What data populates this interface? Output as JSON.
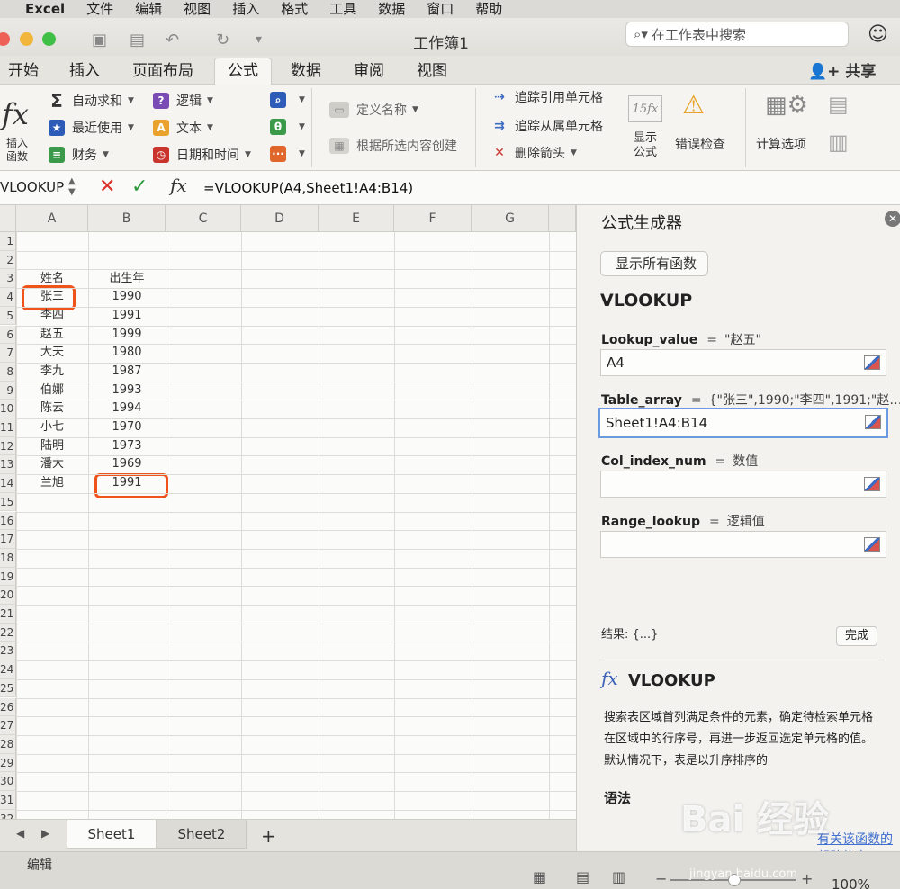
{
  "menubar": {
    "items": [
      "Excel",
      "文件",
      "编辑",
      "视图",
      "插入",
      "格式",
      "工具",
      "数据",
      "窗口",
      "帮助"
    ]
  },
  "window": {
    "title": "工作簿1"
  },
  "search": {
    "placeholder": "在工作表中搜索"
  },
  "tabs": [
    "开始",
    "插入",
    "页面布局",
    "公式",
    "数据",
    "审阅",
    "视图"
  ],
  "active_tab": "公式",
  "share_label": "共享",
  "ribbon": {
    "insert_function": "插入\n函数",
    "autosum": "自动求和",
    "recently_used": "最近使用",
    "financial": "财务",
    "logical": "逻辑",
    "text": "文本",
    "date_time": "日期和时间",
    "define_name": "定义名称",
    "create_from_selection": "根据所选内容创建",
    "trace_precedents": "追踪引用单元格",
    "trace_dependents": "追踪从属单元格",
    "remove_arrows": "删除箭头",
    "show_formulas": "显示\n公式",
    "error_checking": "错误检查",
    "calc_options": "计算选项"
  },
  "formula_bar": {
    "name_box": "VLOOKUP",
    "formula": "=VLOOKUP(A4,Sheet1!A4:B14)"
  },
  "grid": {
    "columns": [
      "A",
      "B",
      "C",
      "D",
      "E",
      "F",
      "G"
    ],
    "header_row": {
      "a": "姓名",
      "b": "出生年"
    },
    "rows": [
      {
        "a": "张三",
        "b": "1990"
      },
      {
        "a": "李四",
        "b": "1991"
      },
      {
        "a": "赵五",
        "b": "1999"
      },
      {
        "a": "大天",
        "b": "1980"
      },
      {
        "a": "李九",
        "b": "1987"
      },
      {
        "a": "伯娜",
        "b": "1993"
      },
      {
        "a": "陈云",
        "b": "1994"
      },
      {
        "a": "小七",
        "b": "1970"
      },
      {
        "a": "陆明",
        "b": "1973"
      },
      {
        "a": "潘大",
        "b": "1969"
      },
      {
        "a": "兰旭",
        "b": "1991"
      }
    ],
    "row_numbers": [
      "1",
      "2",
      "3",
      "4",
      "5",
      "6",
      "7",
      "8",
      "9",
      "10",
      "11",
      "12",
      "13",
      "14",
      "15",
      "16",
      "17",
      "18",
      "19",
      "20",
      "21",
      "22",
      "23",
      "24",
      "25",
      "26",
      "27",
      "28",
      "29",
      "30",
      "31",
      "32"
    ],
    "highlighted_cells": [
      "A4",
      "B14"
    ]
  },
  "sheets": [
    "Sheet1",
    "Sheet2"
  ],
  "active_sheet": "Sheet1",
  "status": {
    "mode": "编辑",
    "zoom": "100%"
  },
  "builder": {
    "title": "公式生成器",
    "show_all": "显示所有函数",
    "function_name": "VLOOKUP",
    "args": [
      {
        "name": "Lookup_value",
        "preview": "\"赵五\"",
        "input": "A4"
      },
      {
        "name": "Table_array",
        "preview": "{\"张三\",1990;\"李四\",1991;\"赵…",
        "input": "Sheet1!A4:B14"
      },
      {
        "name": "Col_index_num",
        "preview": "数值",
        "input": ""
      },
      {
        "name": "Range_lookup",
        "preview": "逻辑值",
        "input": ""
      }
    ],
    "result": "结果: {...}",
    "done": "完成",
    "help_title": "VLOOKUP",
    "description": "搜索表区域首列满足条件的元素，确定待检索单元格在区域中的行序号，再进一步返回选定单元格的值。默认情况下，表是以升序排序的",
    "syntax": "语法",
    "more_help": "有关该函数的帮助信息"
  },
  "watermark": {
    "text": "Bai 经验",
    "url": "jingyan.baidu.com"
  },
  "colors": {
    "highlight": "#f0521c",
    "focus_border": "#6a9ae0",
    "link": "#3f6fcf"
  }
}
